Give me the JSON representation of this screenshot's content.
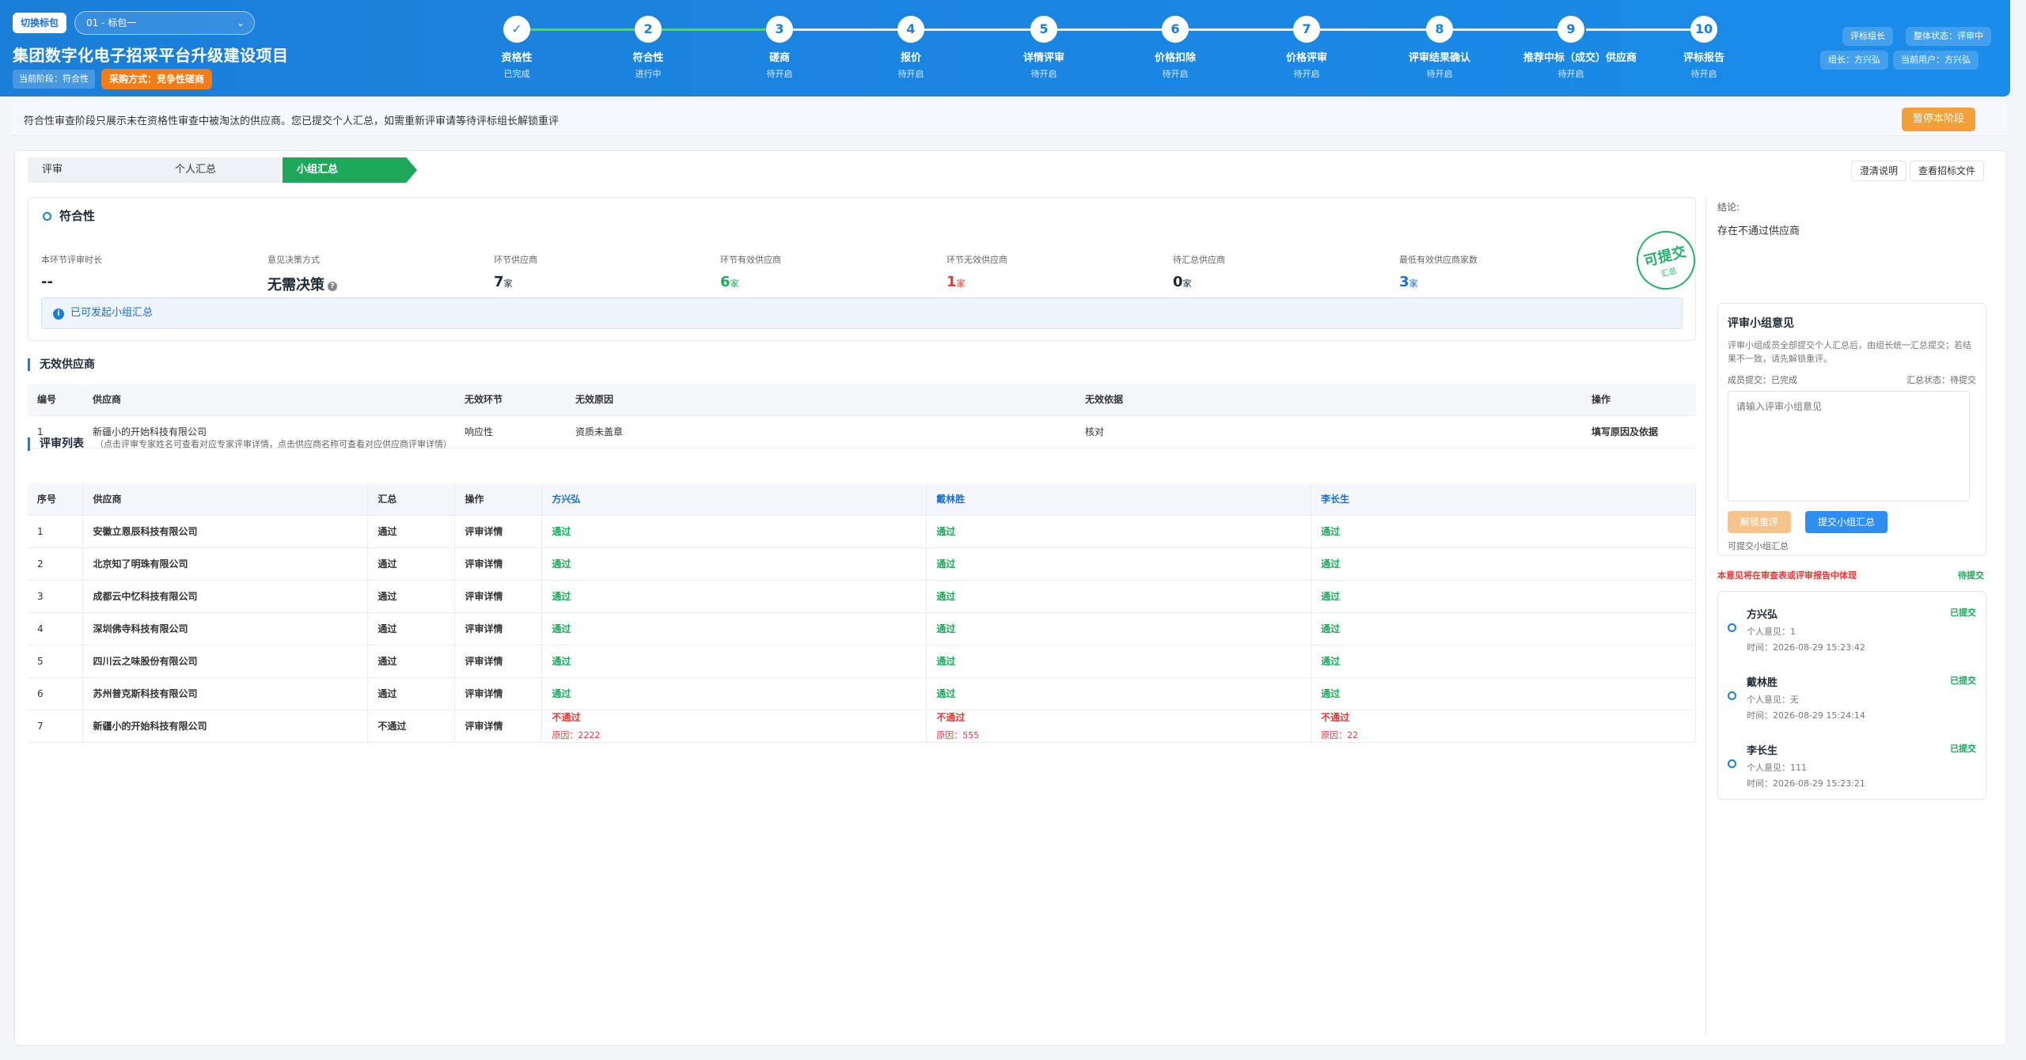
{
  "header": {
    "switch_pkg_label": "切换标包",
    "pkg_select": "01 - 标包一",
    "project_title": "集团数字化电子招采平台升级建设项目",
    "current_stage": "当前阶段：符合性",
    "procurement": "采购方式：竞争性磋商",
    "role_tag": "评标组长",
    "overall_status": "整体状态：评审中",
    "leader": "组长：方兴弘",
    "current_user": "当前用户：方兴弘"
  },
  "steps": [
    {
      "num": "✓",
      "name": "资格性",
      "status": "已完成"
    },
    {
      "num": "2",
      "name": "符合性",
      "status": "进行中"
    },
    {
      "num": "3",
      "name": "磋商",
      "status": "待开启"
    },
    {
      "num": "4",
      "name": "报价",
      "status": "待开启"
    },
    {
      "num": "5",
      "name": "详情评审",
      "status": "待开启"
    },
    {
      "num": "6",
      "name": "价格扣除",
      "status": "待开启"
    },
    {
      "num": "7",
      "name": "价格评审",
      "status": "待开启"
    },
    {
      "num": "8",
      "name": "评审结果确认",
      "status": "待开启"
    },
    {
      "num": "9",
      "name": "推荐中标（成交）供应商",
      "status": "待开启"
    },
    {
      "num": "10",
      "name": "评标报告",
      "status": "待开启"
    }
  ],
  "notice": {
    "text": "符合性审查阶段只展示未在资格性审查中被淘汰的供应商。您已提交个人汇总，如需重新评审请等待评标组长解锁重评",
    "pause_button": "暂停本阶段"
  },
  "tabs": [
    "评审",
    "个人汇总",
    "小组汇总"
  ],
  "top_buttons": {
    "clarify": "澄清说明",
    "view_files": "查看招标文件"
  },
  "summary": {
    "title": "符合性",
    "metrics": [
      {
        "label": "本环节评审时长",
        "value": "--",
        "unit": ""
      },
      {
        "label": "意见决策方式",
        "value": "无需决策",
        "unit": ""
      },
      {
        "label": "环节供应商",
        "value": "7",
        "unit": "家"
      },
      {
        "label": "环节有效供应商",
        "value": "6",
        "unit": "家"
      },
      {
        "label": "环节无效供应商",
        "value": "1",
        "unit": "家"
      },
      {
        "label": "待汇总供应商",
        "value": "0",
        "unit": "家"
      },
      {
        "label": "最低有效供应商家数",
        "value": "3",
        "unit": "家"
      }
    ],
    "stamp_main": "可提交",
    "stamp_sub": "汇总",
    "info": "已可发起小组汇总"
  },
  "invalid": {
    "title": "无效供应商",
    "headers": [
      "编号",
      "供应商",
      "无效环节",
      "无效原因",
      "无效依据",
      "操作"
    ],
    "rows": [
      {
        "no": "1",
        "supplier": "新疆小的开始科技有限公司",
        "stage": "响应性",
        "reason": "资质未盖章",
        "basis": "核对",
        "action": "填写原因及依据"
      }
    ]
  },
  "review": {
    "title": "评审列表",
    "hint": "（点击评审专家姓名可查看对应专家评审详情，点击供应商名称可查看对应供应商评审详情）",
    "headers": [
      "序号",
      "供应商",
      "汇总",
      "操作",
      "方兴弘",
      "戴林胜",
      "李长生"
    ],
    "rows": [
      {
        "no": "1",
        "supplier": "安徽立恩辰科技有限公司",
        "sum": "通过",
        "op": "评审详情",
        "e1": "通过",
        "r1": "",
        "e2": "通过",
        "r2": "",
        "e3": "通过",
        "r3": ""
      },
      {
        "no": "2",
        "supplier": "北京知了明珠有限公司",
        "sum": "通过",
        "op": "评审详情",
        "e1": "通过",
        "r1": "",
        "e2": "通过",
        "r2": "",
        "e3": "通过",
        "r3": ""
      },
      {
        "no": "3",
        "supplier": "成都云中忆科技有限公司",
        "sum": "通过",
        "op": "评审详情",
        "e1": "通过",
        "r1": "",
        "e2": "通过",
        "r2": "",
        "e3": "通过",
        "r3": ""
      },
      {
        "no": "4",
        "supplier": "深圳佛寺科技有限公司",
        "sum": "通过",
        "op": "评审详情",
        "e1": "通过",
        "r1": "",
        "e2": "通过",
        "r2": "",
        "e3": "通过",
        "r3": ""
      },
      {
        "no": "5",
        "supplier": "四川云之味股份有限公司",
        "sum": "通过",
        "op": "评审详情",
        "e1": "通过",
        "r1": "",
        "e2": "通过",
        "r2": "",
        "e3": "通过",
        "r3": ""
      },
      {
        "no": "6",
        "supplier": "苏州普克斯科技有限公司",
        "sum": "通过",
        "op": "评审详情",
        "e1": "通过",
        "r1": "",
        "e2": "通过",
        "r2": "",
        "e3": "通过",
        "r3": ""
      },
      {
        "no": "7",
        "supplier": "新疆小的开始科技有限公司",
        "sum": "不通过",
        "op": "评审详情",
        "e1": "不通过",
        "r1": "原因：2222",
        "e2": "不通过",
        "r2": "原因：555",
        "e3": "不通过",
        "r3": "原因：22"
      }
    ]
  },
  "side": {
    "conclusion_label": "结论:",
    "conclusion_value": "存在不通过供应商",
    "opinion_title": "评审小组意见",
    "opinion_desc": "评审小组成员全部提交个人汇总后，由组长统一汇总提交；若结果不一致，请先解锁重评。",
    "member_submit": "成员提交：已完成",
    "summary_status": "汇总状态：待提交",
    "placeholder": "请输入评审小组意见",
    "unlock_btn": "解锁重评",
    "submit_btn": "提交小组汇总",
    "can_submit": "可提交小组汇总",
    "warn": "本意见将在审查表或评审报告中体现",
    "pending": "待提交",
    "members": [
      {
        "name": "方兴弘",
        "status": "已提交",
        "opinion": "个人意见：1",
        "time": "时间：2026-08-29 15:23:42"
      },
      {
        "name": "戴林胜",
        "status": "已提交",
        "opinion": "个人意见：无",
        "time": "时间：2026-08-29 15:24:14"
      },
      {
        "name": "李长生",
        "status": "已提交",
        "opinion": "个人意见：111",
        "time": "时间：2026-08-29 15:23:21"
      }
    ]
  }
}
